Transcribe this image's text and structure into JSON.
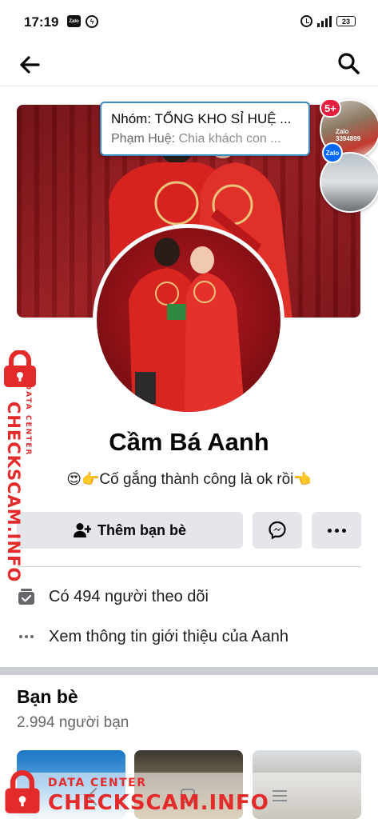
{
  "status_bar": {
    "time": "17:19",
    "zalo_icon_label": "Zalo",
    "battery": "23",
    "icons": [
      "zalo-icon",
      "messenger-icon",
      "alarm-icon",
      "signal-icon",
      "battery-icon"
    ]
  },
  "top_nav": {
    "icons": [
      "back-arrow-icon",
      "search-icon"
    ]
  },
  "chat_bubble": {
    "title": "Nhóm: TỔNG KHO SỈ HUỆ ...",
    "sender": "Phạm Huệ:",
    "preview": "Chia khách con ..."
  },
  "chat_heads": {
    "badge": "5+",
    "zalo_label": "Zalo",
    "phone_fragment": "3394899"
  },
  "profile": {
    "name": "Cầm Bá Aanh",
    "bio_prefix_emoji": "😍👉",
    "bio_text": "Cố gắng thành công là ok rồi",
    "bio_suffix_emoji": "👈"
  },
  "actions": {
    "add_friend_label": "Thêm bạn bè",
    "icons": [
      "add-friend-icon",
      "messenger-icon",
      "more-icon"
    ]
  },
  "info": {
    "followers": "Có 494 người theo dõi",
    "about": "Xem thông tin giới thiệu của Aanh"
  },
  "friends": {
    "title": "Bạn bè",
    "count": "2.994 người bạn"
  },
  "watermark": {
    "sub": "DATA CENTER",
    "main": "CHECKSCAM.INFO",
    "color": "#e32b2b"
  },
  "colors": {
    "button_bg": "#e4e6eb",
    "bubble_border": "#3b8ac4",
    "badge": "#e41e3f"
  }
}
